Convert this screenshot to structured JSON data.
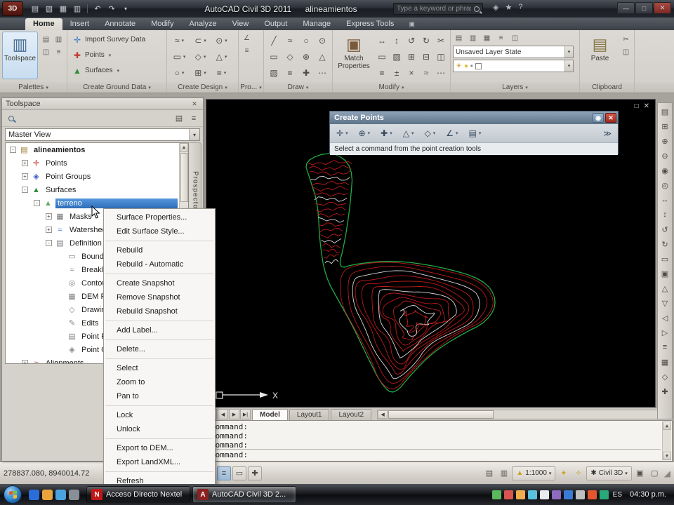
{
  "titlebar": {
    "app_badge": "3D",
    "app_title": "AutoCAD Civil 3D 2011",
    "doc_title": "alineamientos",
    "search_placeholder": "Type a keyword or phrase"
  },
  "ribbon": {
    "tabs": [
      "Home",
      "Insert",
      "Annotate",
      "Modify",
      "Analyze",
      "View",
      "Output",
      "Manage",
      "Express Tools"
    ],
    "panel_labels": {
      "palettes": "Palettes",
      "ground": "Create Ground Data",
      "design": "Create Design",
      "pro": "Pro...",
      "draw": "Draw",
      "modify": "Modify",
      "layers": "Layers",
      "clipboard": "Clipboard"
    },
    "buttons": {
      "toolspace": "Toolspace",
      "import_survey": "Import Survey Data",
      "points": "Points",
      "surfaces": "Surfaces",
      "match_properties": "Match Properties",
      "layer_state": "Unsaved Layer State",
      "paste": "Paste"
    }
  },
  "toolspace": {
    "title": "Toolspace",
    "view_selector": "Master View",
    "side_tab": "Prospector",
    "tree": [
      "alineamientos",
      "Points",
      "Point Groups",
      "Surfaces",
      "terreno",
      "Masks",
      "Watersheds",
      "Definition",
      "Boundaries",
      "Breaklines",
      "Contours",
      "DEM Files",
      "Drawing Objects",
      "Edits",
      "Point Files",
      "Point Groups",
      "Alignments"
    ]
  },
  "context_menu": {
    "items": [
      "Surface Properties...",
      "Edit Surface Style...",
      "Rebuild",
      "Rebuild - Automatic",
      "Create Snapshot",
      "Remove Snapshot",
      "Rebuild Snapshot",
      "Add Label...",
      "Delete...",
      "Select",
      "Zoom to",
      "Pan to",
      "Lock",
      "Unlock",
      "Export to DEM...",
      "Export LandXML...",
      "Refresh"
    ]
  },
  "create_points": {
    "title": "Create Points",
    "hint": "Select a command from the point creation tools"
  },
  "drawing": {
    "axis_label": "X",
    "boundary_color": "#22aa44",
    "contour_major": "#bb1a1a",
    "contour_minor": "#d9d9d9"
  },
  "layout_tabs": [
    "Model",
    "Layout1",
    "Layout2"
  ],
  "command_line": {
    "history": [
      "Command:",
      "Command:",
      "Command:"
    ],
    "prompt": "Command:"
  },
  "status_bar": {
    "coordinates": "278837.080, 8940014.72",
    "scale": "1:1000",
    "workspace": "Civil 3D"
  },
  "taskbar": {
    "buttons": [
      "Acceso Directo Nextel",
      "AutoCAD Civil 3D 2..."
    ],
    "button_icons": [
      "N",
      "A"
    ],
    "tray_lang": "ES",
    "tray_time": "04:30 p.m."
  }
}
